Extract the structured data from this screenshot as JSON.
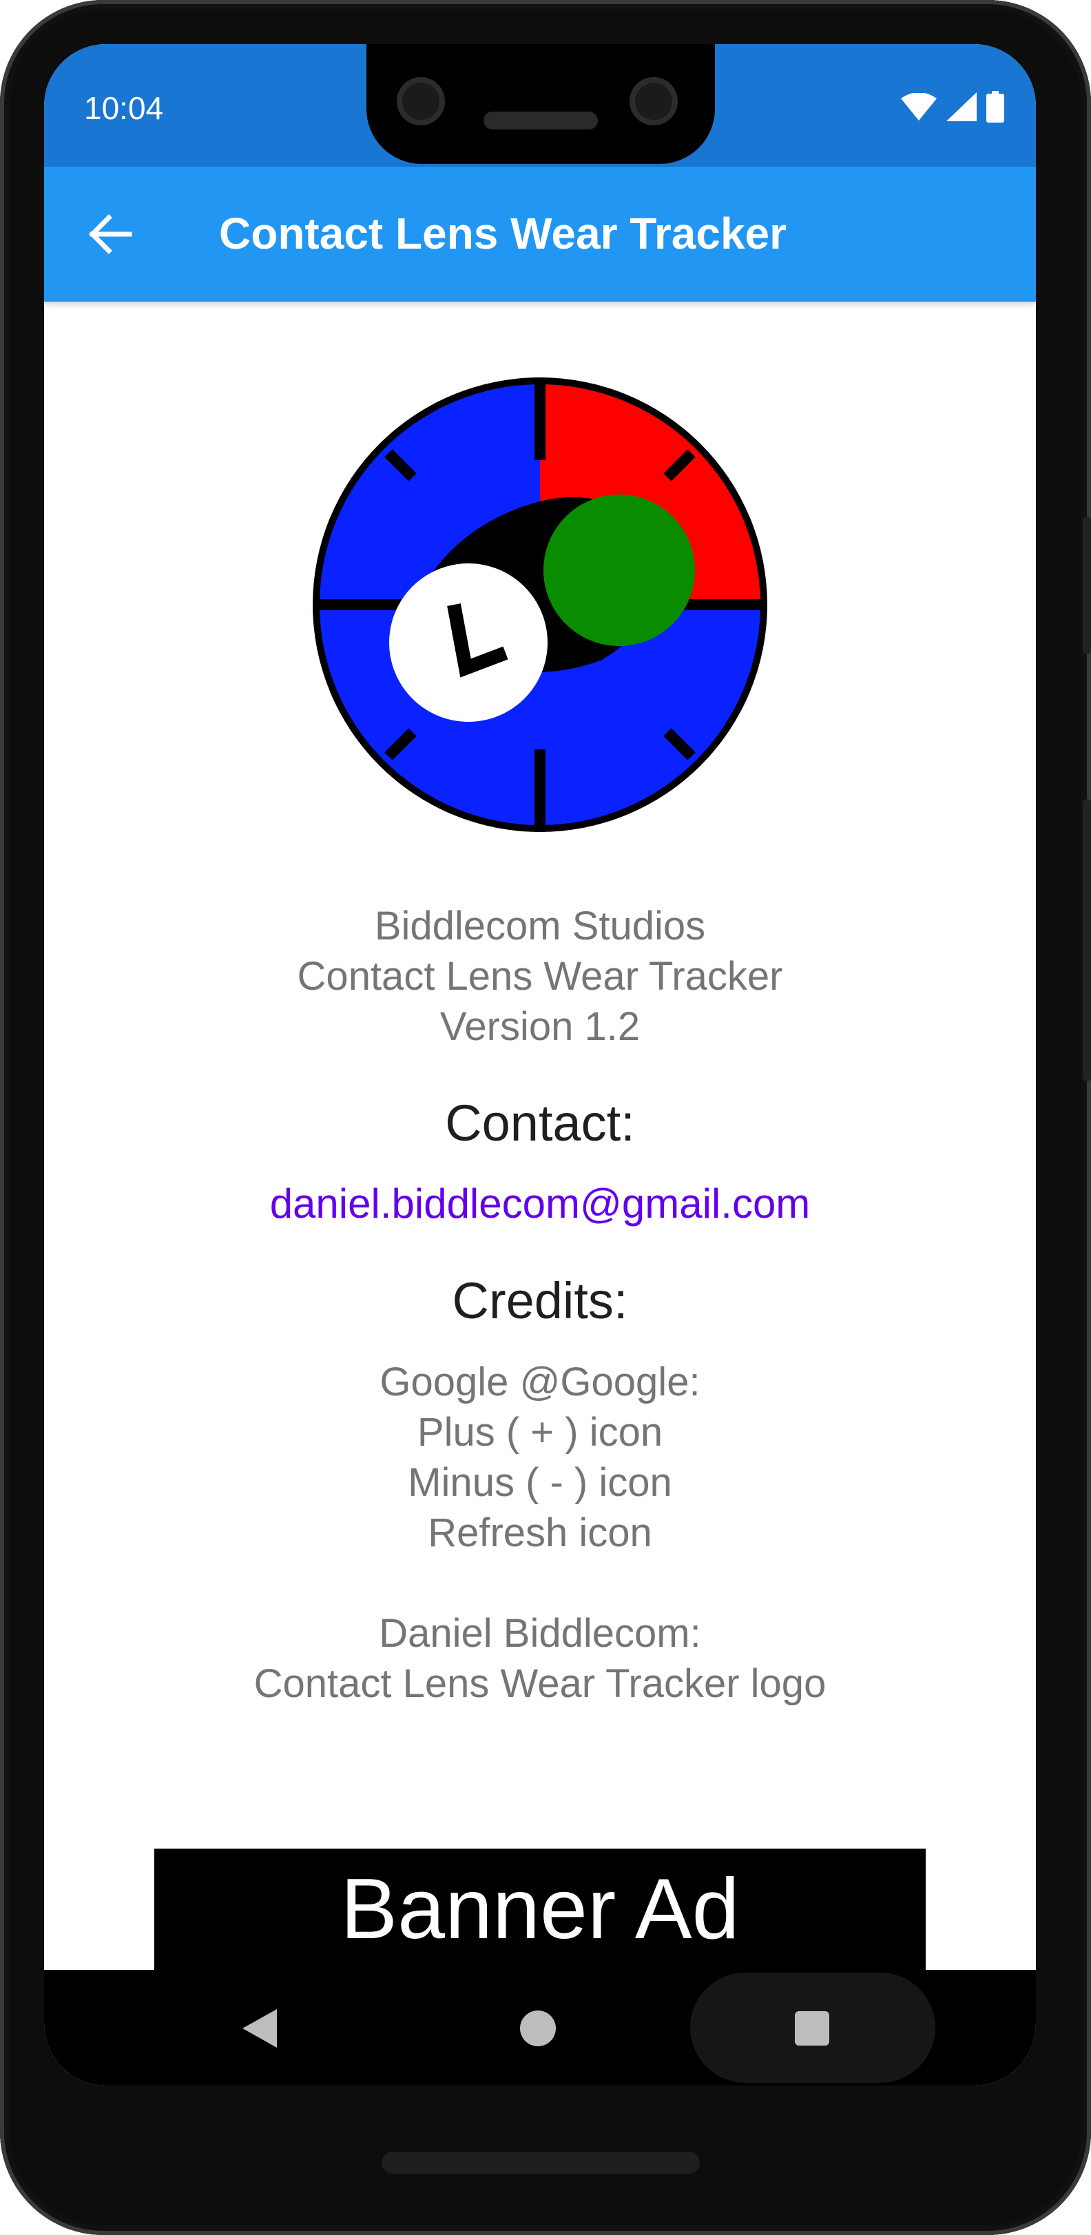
{
  "status_bar": {
    "time": "10:04"
  },
  "app_bar": {
    "title": "Contact Lens Wear Tracker"
  },
  "about": {
    "studio": "Biddlecom Studios",
    "app_name": "Contact Lens Wear Tracker",
    "version": "Version 1.2"
  },
  "contact": {
    "heading": "Contact:",
    "email": "daniel.biddlecom@gmail.com"
  },
  "credits": {
    "heading": "Credits:",
    "lines": [
      "Google @Google:",
      "Plus ( + ) icon",
      "Minus ( - ) icon",
      "Refresh icon",
      "",
      "Daniel Biddlecom:",
      "Contact Lens Wear Tracker logo"
    ]
  },
  "banner_ad": {
    "label": "Banner Ad"
  },
  "colors": {
    "status_bar": "#1976d2",
    "app_bar": "#2196f3",
    "link": "#6200ee",
    "logo_blue": "#0a22ff",
    "logo_red": "#ff0000",
    "logo_green": "#0a8c00"
  },
  "icons": [
    "back-arrow-icon",
    "wifi-icon",
    "cellular-signal-icon",
    "battery-icon",
    "nav-back-icon",
    "nav-home-icon",
    "nav-recents-icon"
  ]
}
